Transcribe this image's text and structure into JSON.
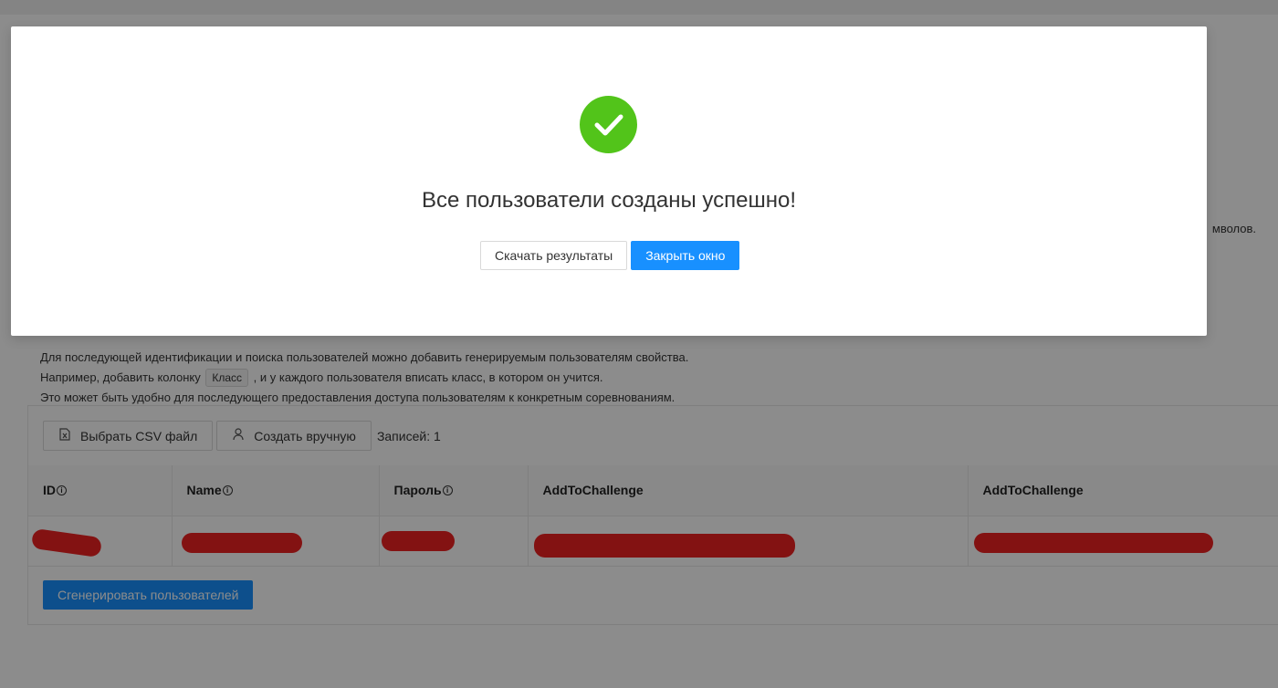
{
  "background": {
    "truncated_text": "мволов.",
    "info_lines": {
      "line1": "Для последующей идентификации и поиска пользователей можно добавить генерируемым пользователям свойства.",
      "line2_before": "Например, добавить колонку",
      "line2_chip": "Класс",
      "line2_after": ", и у каждого пользователя вписать класс, в котором он учится.",
      "line3": "Это может быть удобно для последующего предоставления доступа пользователям к конкретным соревнованиям."
    },
    "toolbar": {
      "csv_button": "Выбрать CSV файл",
      "manual_button": "Создать вручную",
      "records": "Записей: 1"
    },
    "table": {
      "headers": [
        "ID",
        "Name",
        "Пароль",
        "AddToChallenge",
        "AddToChallenge"
      ],
      "info_icon_glyph": "i"
    },
    "generate_button": "Сгенерировать пользователей"
  },
  "modal": {
    "title": "Все пользователи созданы успешно!",
    "download_button": "Скачать результаты",
    "close_button": "Закрыть окно"
  },
  "colors": {
    "success": "#52c41a",
    "primary": "#1890ff",
    "redaction": "#ee2222",
    "overlay": "rgba(0,0,0,0.45)"
  },
  "icons": {
    "success": "check-circle-icon",
    "csv": "file-excel-icon",
    "manual": "user-icon"
  }
}
